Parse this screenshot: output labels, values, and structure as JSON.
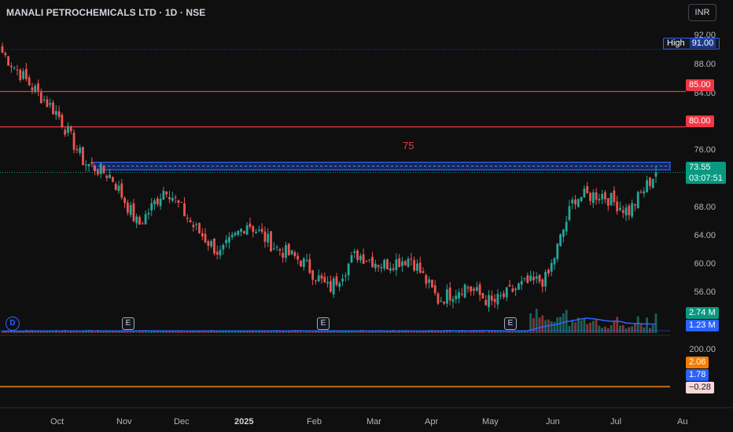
{
  "header": {
    "symbol_title": "MANALI PETROCHEMICALS LTD · 1D · NSE",
    "currency_button": "INR"
  },
  "price_axis": {
    "ticks": [
      "92.00",
      "88.00",
      "84.00",
      "76.00",
      "68.00",
      "64.00",
      "60.00",
      "56.00"
    ],
    "high_label": "High",
    "high_value": "91.00",
    "level_85": "85.00",
    "level_80": "80.00",
    "last_price": "73.55",
    "countdown": "03:07:51",
    "volume_value": "2.74 M",
    "volume_ma_value": "1.23 M"
  },
  "annotation": {
    "zone_label": "75"
  },
  "oscillator_axis": {
    "top_tick": "200.00",
    "value_orange": "2.06",
    "value_blue": "1.78",
    "value_neg": "−0.28"
  },
  "time_axis": {
    "labels": [
      "Oct",
      "Nov",
      "Dec",
      "2025",
      "Feb",
      "Mar",
      "Apr",
      "May",
      "Jun",
      "Jul",
      "Au"
    ]
  },
  "events": {
    "dividend_badge": "D",
    "earnings_badge": "E"
  },
  "colors": {
    "background": "#0f0f0f",
    "up": "#26a69a",
    "down": "#ef5350",
    "level_line": "#f23645",
    "zone": "#2962ff",
    "volume_ma": "#2962ff",
    "osc_orange": "#f57c00"
  },
  "chart_data": {
    "type": "candlestick",
    "x_labels": [
      "Oct",
      "Nov",
      "Dec",
      "2025",
      "Feb",
      "Mar",
      "Apr",
      "May",
      "Jun",
      "Jul",
      "Au"
    ],
    "ylim": [
      53,
      93
    ],
    "horizontal_levels": [
      85.0,
      80.0
    ],
    "zone": {
      "label": "75",
      "low": 73.9,
      "high": 75.0
    },
    "last_close": 73.55,
    "period_high": 91.0,
    "close_path": [
      {
        "x": "Sep",
        "y": 90.5
      },
      {
        "x": "Sep",
        "y": 86.0
      },
      {
        "x": "Oct",
        "y": 82.0
      },
      {
        "x": "Oct",
        "y": 75.0
      },
      {
        "x": "Oct",
        "y": 73.0
      },
      {
        "x": "Nov",
        "y": 66.0
      },
      {
        "x": "Nov",
        "y": 71.5
      },
      {
        "x": "Nov",
        "y": 66.0
      },
      {
        "x": "Dec",
        "y": 62.0
      },
      {
        "x": "Dec",
        "y": 66.5
      },
      {
        "x": "2025",
        "y": 63.0
      },
      {
        "x": "2025",
        "y": 61.0
      },
      {
        "x": "Feb",
        "y": 57.0
      },
      {
        "x": "Feb",
        "y": 62.0
      },
      {
        "x": "Mar",
        "y": 60.5
      },
      {
        "x": "Mar",
        "y": 61.5
      },
      {
        "x": "Apr",
        "y": 55.5
      },
      {
        "x": "Apr",
        "y": 57.5
      },
      {
        "x": "May",
        "y": 55.0
      },
      {
        "x": "May",
        "y": 57.5
      },
      {
        "x": "Jun",
        "y": 58.5
      },
      {
        "x": "Jun",
        "y": 70.0
      },
      {
        "x": "Jul",
        "y": 70.5
      },
      {
        "x": "Jul",
        "y": 68.0
      },
      {
        "x": "Jul",
        "y": 73.55
      }
    ]
  }
}
